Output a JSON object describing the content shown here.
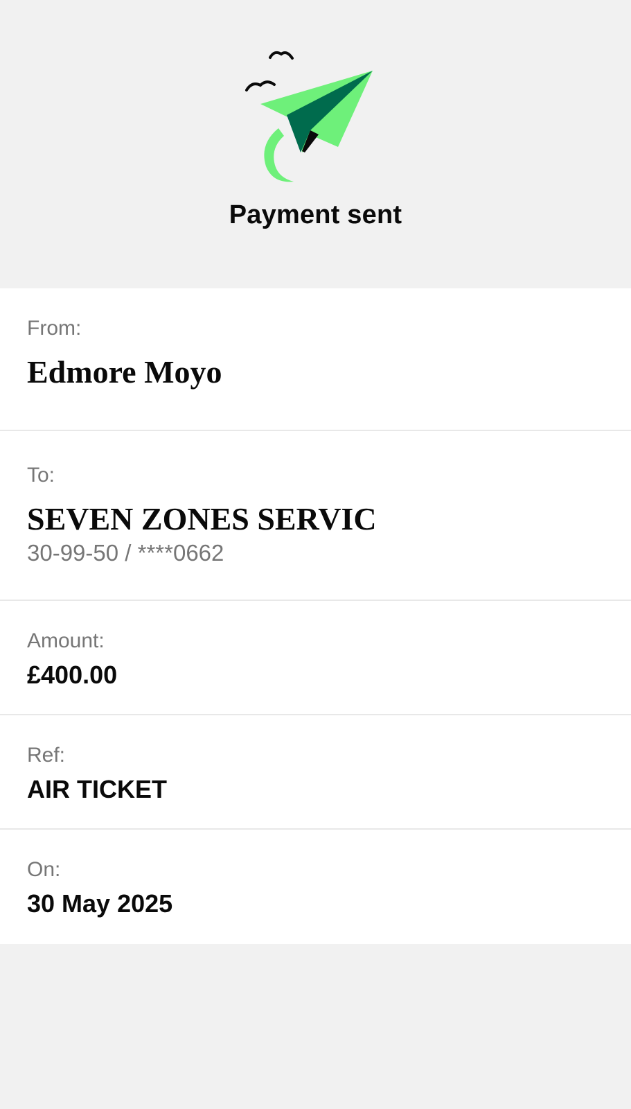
{
  "header": {
    "title": "Payment sent",
    "illustration": "paper-plane-icon"
  },
  "details": {
    "from": {
      "label": "From:",
      "value": "Edmore Moyo"
    },
    "to": {
      "label": "To:",
      "value": "SEVEN ZONES SERVIC",
      "account": "30-99-50 / ****0662"
    },
    "amount": {
      "label": "Amount:",
      "value": "£400.00"
    },
    "ref": {
      "label": "Ref:",
      "value": "AIR TICKET"
    },
    "on": {
      "label": "On:",
      "value": "30 May 2025"
    }
  },
  "colors": {
    "background": "#f1f1f1",
    "card": "#ffffff",
    "plane_light": "#6ef07a",
    "plane_dark": "#006b4d",
    "text_primary": "#0a0a0a",
    "text_secondary": "#767676"
  }
}
